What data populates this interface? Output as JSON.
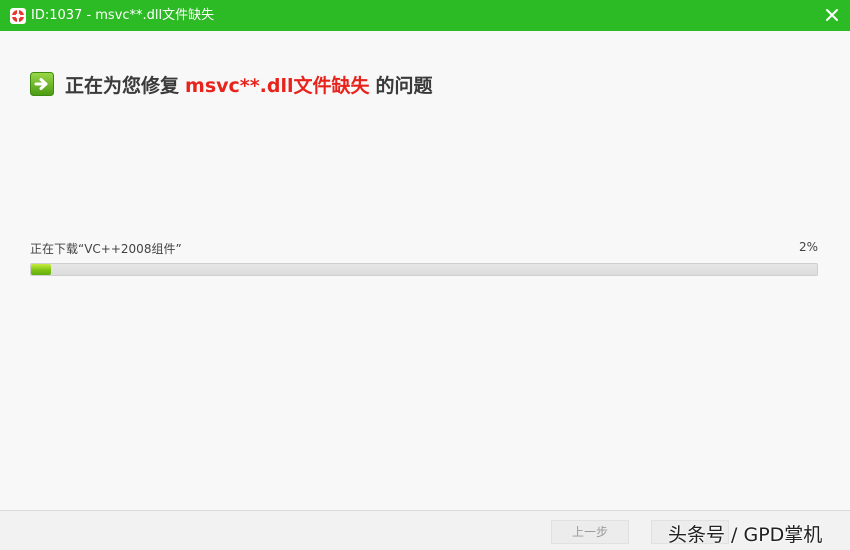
{
  "window": {
    "title": "ID:1037 - msvc**.dll文件缺失",
    "close_icon": "close-icon",
    "app_icon": "lifebuoy-icon"
  },
  "heading": {
    "icon": "green-arrow-icon",
    "prefix": "正在为您修复",
    "highlight": "msvc**.dll文件缺失",
    "suffix": "的问题",
    "highlight_color": "#e8231c"
  },
  "progress": {
    "status": "正在下载“VC++2008组件”",
    "percent_label": "2%",
    "fraction": 0.02
  },
  "footer": {
    "prev_label": "上一步",
    "next_label": ""
  },
  "watermark": "头条号 / GPD掌机",
  "colors": {
    "titlebar": "#2dbb25",
    "accent_green": "#7fc416"
  }
}
